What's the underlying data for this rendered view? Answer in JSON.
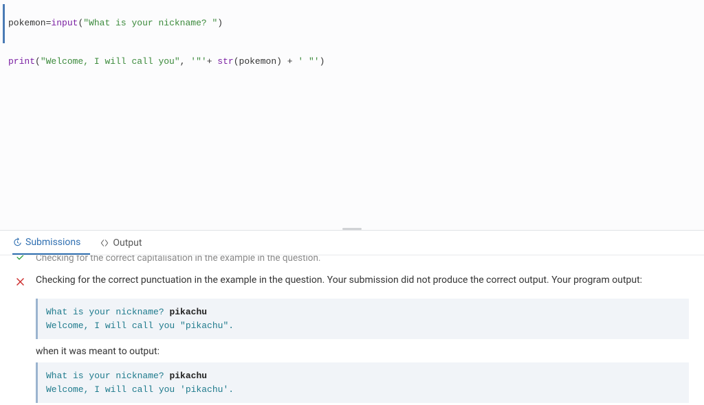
{
  "editor": {
    "line1": {
      "var": "pokemon",
      "assign": "=",
      "builtin": "input",
      "open": "(",
      "str": "\"What is your nickname? \"",
      "close": ")"
    },
    "line2": {
      "builtin1": "print",
      "open": "(",
      "str1": "\"Welcome, I will call you\"",
      "comma": ", ",
      "str2": "'\"'",
      "plus1": "+ ",
      "builtin2": "str",
      "open2": "(",
      "var": "pokemon",
      "close2": ") ",
      "plus2": "+ ",
      "str3": "' \"'",
      "close": ")"
    }
  },
  "tabs": {
    "submissions": "Submissions",
    "output": "Output"
  },
  "results": {
    "prev_truncated": "Checking for the correct capitalisation in the example in the question.",
    "fail_text": "Checking for the correct punctuation in the example in the question. Your submission did not produce the correct output. Your program output:",
    "actual_output": {
      "line1a": "What is your nickname? ",
      "line1b": "pikachu",
      "line2": "Welcome, I will call you \"pikachu\"."
    },
    "caption": "when it was meant to output:",
    "expected_output": {
      "line1a": "What is your nickname? ",
      "line1b": "pikachu",
      "line2": "Welcome, I will call you 'pikachu'."
    }
  }
}
